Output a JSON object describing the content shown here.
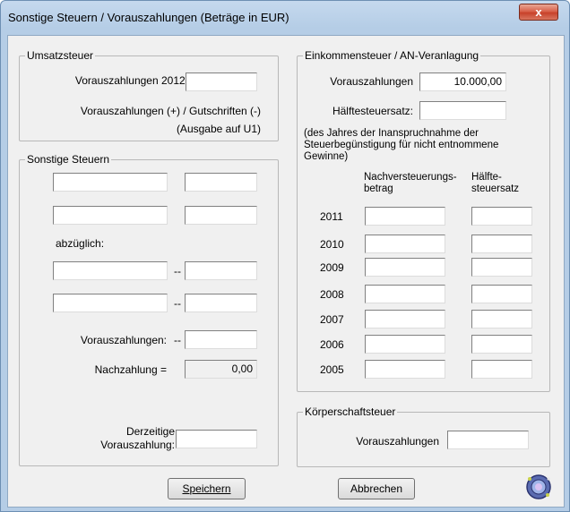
{
  "window": {
    "title": "Sonstige Steuern / Vorauszahlungen (Beträge in EUR)",
    "close_symbol": "x"
  },
  "umsatzsteuer": {
    "legend": "Umsatzsteuer",
    "vz_2012_label": "Vorauszahlungen 2012:",
    "vz_2012_value": "",
    "gutschriften_line1": "Vorauszahlungen (+) / Gutschriften (-)",
    "gutschriften_line2": "(Ausgabe auf U1)"
  },
  "sonstige": {
    "legend": "Sonstige Steuern",
    "abzueglich_label": "abzüglich:",
    "minus_sign": "--",
    "vz_label": "Vorauszahlungen:",
    "nachzahlung_label": "Nachzahlung =",
    "nachzahlung_value": "0,00",
    "derzeitige_line1": "Derzeitige",
    "derzeitige_line2": "Vorauszahlung:"
  },
  "einkommensteuer": {
    "legend": "Einkommensteuer / AN-Veranlagung",
    "vz_label": "Vorauszahlungen",
    "vz_value": "10.000,00",
    "haelfte_label": "Hälftesteuersatz:",
    "note_line1": "(des Jahres der Inanspruchnahme der",
    "note_line2": "Steuerbegünstigung für nicht entnommene",
    "note_line3": "Gewinne)",
    "col_nach_line1": "Nachversteuerungs-",
    "col_nach_line2": "betrag",
    "col_haelfte_line1": "Hälfte-",
    "col_haelfte_line2": "steuersatz",
    "years": [
      "2011",
      "2010",
      "2009",
      "2008",
      "2007",
      "2006",
      "2005"
    ]
  },
  "koerperschaft": {
    "legend": "Körperschaftsteuer",
    "vz_label": "Vorauszahlungen"
  },
  "buttons": {
    "speichern": "Speichern",
    "abbrechen": "Abbrechen"
  },
  "colors": {
    "titlebar": "#b5cde6",
    "close": "#c8412a",
    "panel": "#f0f0f0"
  },
  "icons": {
    "help": "help-globe-icon"
  }
}
